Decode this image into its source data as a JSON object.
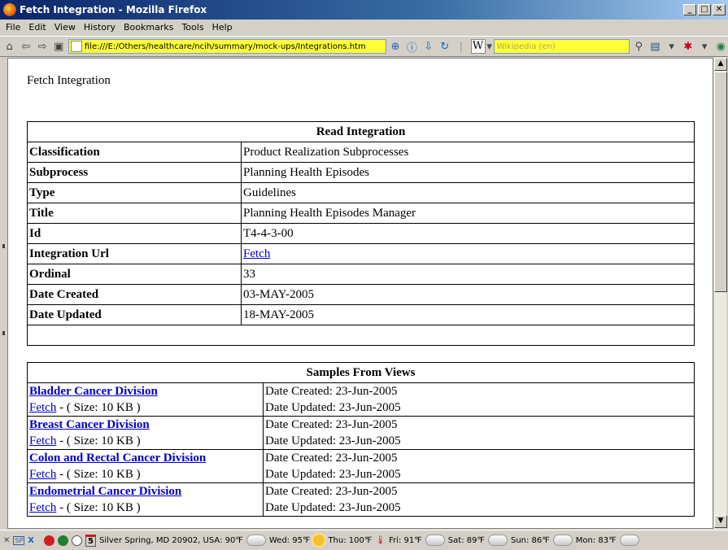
{
  "window": {
    "title": "Fetch Integration - Mozilla Firefox"
  },
  "menu": {
    "items": [
      "File",
      "Edit",
      "View",
      "History",
      "Bookmarks",
      "Tools",
      "Help"
    ]
  },
  "navbar": {
    "url": "file:///E:/Others/healthcare/ncih/summary/mock-ups/Integrations.htm",
    "search_placeholder": "Wikipedia (en)",
    "wiki_label": "W"
  },
  "page": {
    "heading": "Fetch Integration",
    "read_integration": {
      "header": "Read Integration",
      "rows": [
        {
          "label": "Classification",
          "value": "Product Realization Subprocesses"
        },
        {
          "label": "Subprocess",
          "value": "Planning Health Episodes"
        },
        {
          "label": "Type",
          "value": "Guidelines"
        },
        {
          "label": "Title",
          "value": "Planning Health Episodes Manager"
        },
        {
          "label": "Id",
          "value": "T4-4-3-00"
        },
        {
          "label": "Integration Url",
          "value": "Fetch"
        },
        {
          "label": "Ordinal",
          "value": "33"
        },
        {
          "label": "Date Created",
          "value": "03-MAY-2005"
        },
        {
          "label": "Date Updated",
          "value": "18-MAY-2005"
        }
      ]
    },
    "samples": {
      "header": "Samples From Views",
      "rows": [
        {
          "name": "Bladder Cancer Division",
          "fetch": "Fetch",
          "size": " - ( Size: 10 KB )",
          "created": "Date Created: 23-Jun-2005",
          "updated": "Date Updated: 23-Jun-2005"
        },
        {
          "name": "Breast Cancer Division",
          "fetch": "Fetch",
          "size": " - ( Size: 10 KB )",
          "created": "Date Created: 23-Jun-2005",
          "updated": "Date Updated: 23-Jun-2005"
        },
        {
          "name": "Colon and Rectal Cancer Division",
          "fetch": "Fetch",
          "size": " - ( Size: 10 KB )",
          "created": "Date Created: 23-Jun-2005",
          "updated": "Date Updated: 23-Jun-2005"
        },
        {
          "name": "Endometrial Cancer Division",
          "fetch": "Fetch",
          "size": " - ( Size: 10 KB )",
          "created": "Date Created: 23-Jun-2005",
          "updated": "Date Updated: 23-Jun-2005"
        }
      ]
    }
  },
  "statusbar": {
    "calendar_day": "5",
    "location": "Silver Spring, MD 20902, USA: 90℉",
    "forecast": [
      {
        "label": "Wed: 95℉",
        "icon": "partly-cloudy-icon"
      },
      {
        "label": "Thu: 100℉",
        "icon": "sun-icon"
      },
      {
        "label": "Fri: 91℉",
        "icon": "partly-cloudy-icon"
      },
      {
        "label": "Sat: 89℉",
        "icon": "partly-cloudy-icon"
      },
      {
        "label": "Sun: 86℉",
        "icon": "partly-cloudy-icon"
      },
      {
        "label": "Mon: 83℉",
        "icon": "cloud-icon"
      }
    ]
  }
}
